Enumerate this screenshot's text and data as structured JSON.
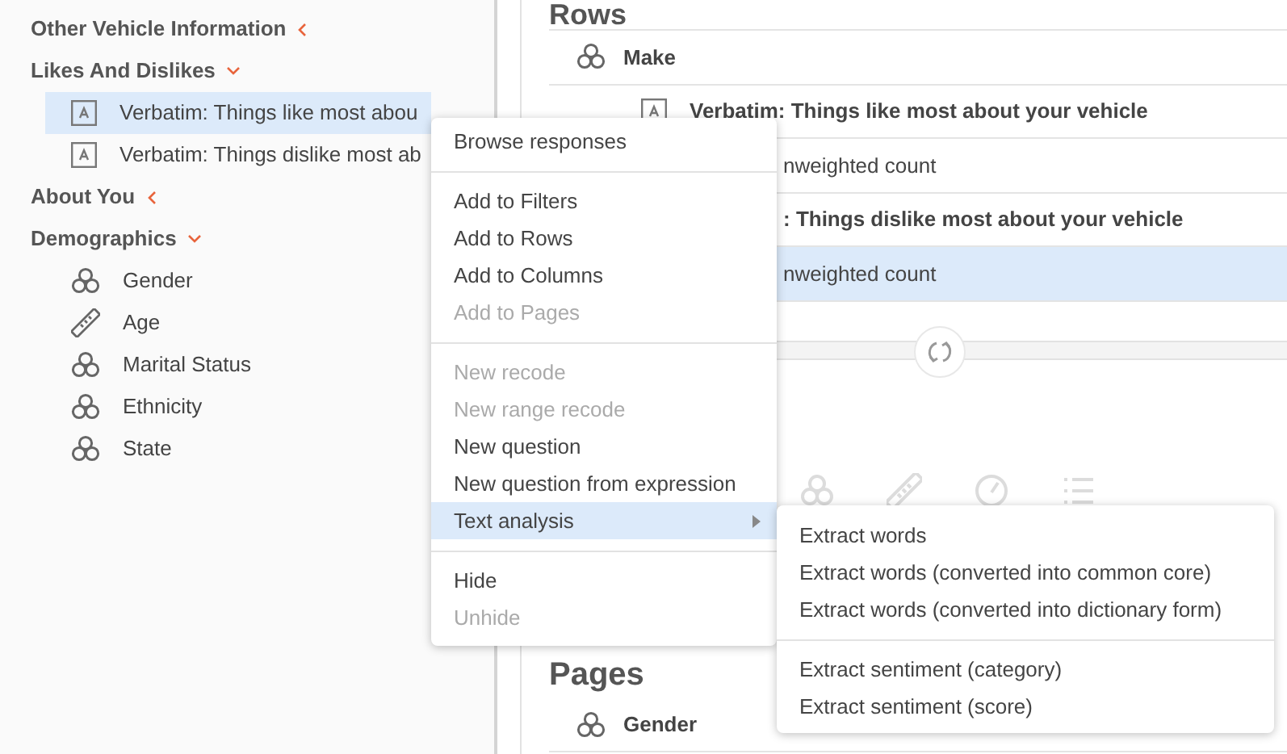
{
  "sidebar": {
    "groups": [
      {
        "label": "Other Vehicle Information",
        "expanded": false
      },
      {
        "label": "Likes And Dislikes",
        "expanded": true,
        "children": [
          {
            "kind": "text",
            "label": "Verbatim: Things like most abou",
            "selected": true
          },
          {
            "kind": "text",
            "label": "Verbatim: Things dislike most ab",
            "selected": false
          }
        ]
      },
      {
        "label": "About You",
        "expanded": false
      },
      {
        "label": "Demographics",
        "expanded": true,
        "children": [
          {
            "kind": "categorical",
            "label": "Gender",
            "selected": false
          },
          {
            "kind": "numeric",
            "label": "Age",
            "selected": false
          },
          {
            "kind": "categorical",
            "label": "Marital Status",
            "selected": false
          },
          {
            "kind": "categorical",
            "label": "Ethnicity",
            "selected": false
          },
          {
            "kind": "categorical",
            "label": "State",
            "selected": false
          }
        ]
      }
    ]
  },
  "rows_panel": {
    "title": "Rows",
    "rows": [
      {
        "kind": "variable",
        "label": "Make",
        "selected": false
      },
      {
        "kind": "question",
        "label": "Verbatim: Things like most about your vehicle",
        "selected": false
      },
      {
        "kind": "statistic",
        "label": "nweighted count",
        "selected": false
      },
      {
        "kind": "question_covered",
        "label": ": Things dislike most about your vehicle",
        "selected": false
      },
      {
        "kind": "statistic",
        "label": "nweighted count",
        "selected": true
      }
    ]
  },
  "pages_panel": {
    "title": "Pages",
    "rows": [
      {
        "kind": "variable",
        "label": "Gender",
        "selected": false
      }
    ]
  },
  "context_menu": {
    "sections": [
      [
        {
          "label": "Browse responses",
          "disabled": false,
          "selected": false,
          "submenu": false
        }
      ],
      [
        {
          "label": "Add to Filters",
          "disabled": false,
          "selected": false,
          "submenu": false
        },
        {
          "label": "Add to Rows",
          "disabled": false,
          "selected": false,
          "submenu": false
        },
        {
          "label": "Add to Columns",
          "disabled": false,
          "selected": false,
          "submenu": false
        },
        {
          "label": "Add to Pages",
          "disabled": true,
          "selected": false,
          "submenu": false
        }
      ],
      [
        {
          "label": "New recode",
          "disabled": true,
          "selected": false,
          "submenu": false
        },
        {
          "label": "New range recode",
          "disabled": true,
          "selected": false,
          "submenu": false
        },
        {
          "label": "New question",
          "disabled": false,
          "selected": false,
          "submenu": false
        },
        {
          "label": "New question from expression",
          "disabled": false,
          "selected": false,
          "submenu": false
        },
        {
          "label": "Text analysis",
          "disabled": false,
          "selected": true,
          "submenu": true
        }
      ],
      [
        {
          "label": "Hide",
          "disabled": false,
          "selected": false,
          "submenu": false
        },
        {
          "label": "Unhide",
          "disabled": true,
          "selected": false,
          "submenu": false
        }
      ]
    ]
  },
  "submenu": {
    "sections": [
      [
        {
          "label": "Extract words",
          "disabled": false,
          "selected": false
        },
        {
          "label": "Extract words (converted into common core)",
          "disabled": false,
          "selected": false
        },
        {
          "label": "Extract words (converted into dictionary form)",
          "disabled": false,
          "selected": false
        }
      ],
      [
        {
          "label": "Extract sentiment (category)",
          "disabled": false,
          "selected": false
        },
        {
          "label": "Extract sentiment (score)",
          "disabled": false,
          "selected": false
        }
      ]
    ]
  }
}
